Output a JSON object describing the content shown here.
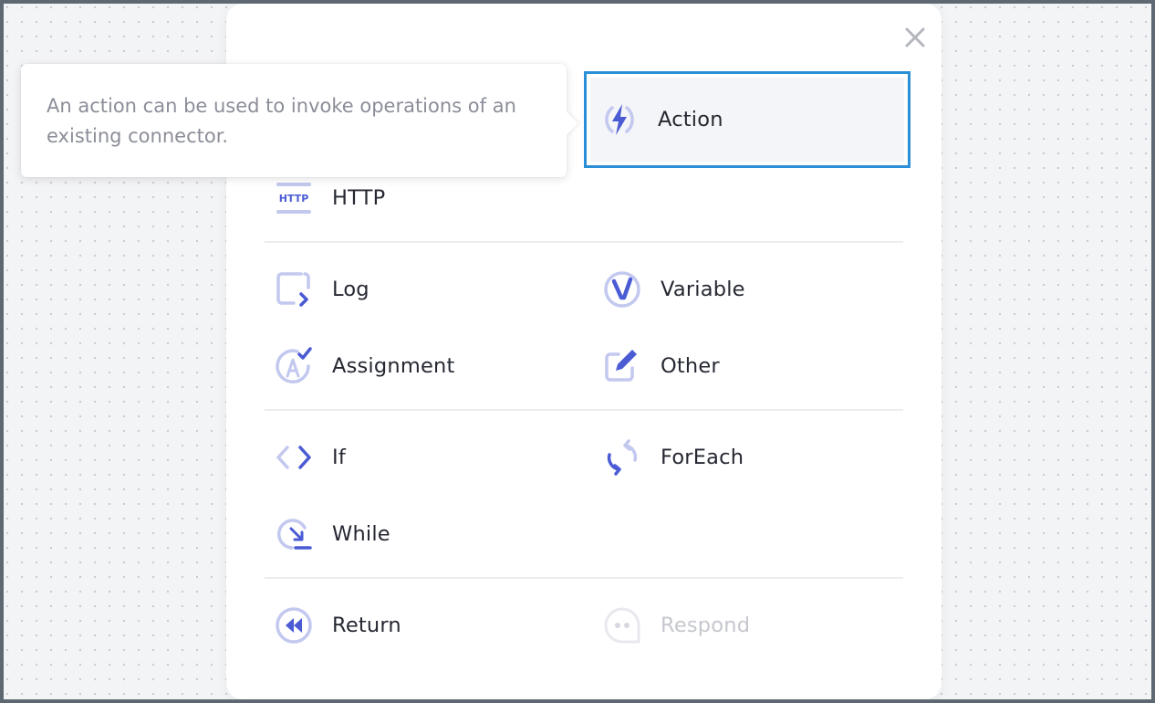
{
  "dialog": {
    "close_label": "×"
  },
  "tooltip": {
    "text": "An action can be used to invoke operations of an existing connector."
  },
  "items": {
    "action": {
      "label": "Action",
      "icon": "lightning-icon"
    },
    "http": {
      "label": "HTTP",
      "icon": "http-icon",
      "icon_text": "HTTP"
    },
    "log": {
      "label": "Log",
      "icon": "log-icon"
    },
    "variable": {
      "label": "Variable",
      "icon": "variable-icon"
    },
    "assignment": {
      "label": "Assignment",
      "icon": "assignment-icon"
    },
    "other": {
      "label": "Other",
      "icon": "edit-icon"
    },
    "if": {
      "label": "If",
      "icon": "code-brackets-icon"
    },
    "foreach": {
      "label": "ForEach",
      "icon": "loop-icon"
    },
    "while": {
      "label": "While",
      "icon": "while-icon"
    },
    "return": {
      "label": "Return",
      "icon": "rewind-icon"
    },
    "respond": {
      "label": "Respond",
      "icon": "chat-bubble-icon",
      "disabled": true
    }
  },
  "colors": {
    "accent": "#4a5bd4",
    "accent_light": "#c3c8ef",
    "selection_border": "#2a8fd6",
    "text": "#262832",
    "muted_text": "#8b8e99",
    "disabled_text": "#c6c8cf"
  }
}
